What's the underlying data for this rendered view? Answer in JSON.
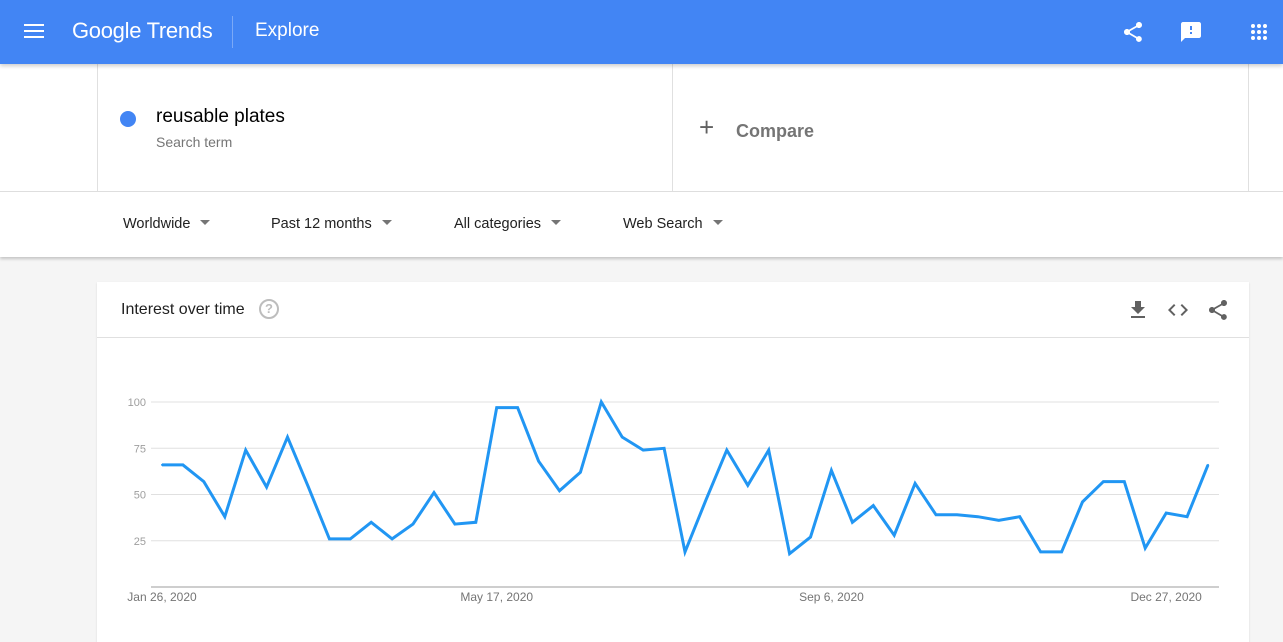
{
  "header": {
    "logo_google": "Google",
    "logo_trends": "Trends",
    "section": "Explore",
    "icons": [
      "menu-icon",
      "share-icon",
      "feedback-icon",
      "apps-icon"
    ]
  },
  "search": {
    "term": "reusable plates",
    "term_subtitle": "Search term",
    "term_color": "#4285f4",
    "compare_label": "Compare"
  },
  "filters": {
    "region": "Worldwide",
    "time": "Past 12 months",
    "category": "All categories",
    "property": "Web Search"
  },
  "card": {
    "title": "Interest over time",
    "help_glyph": "?",
    "icons": [
      "download-icon",
      "embed-icon",
      "share-icon"
    ]
  },
  "chart_data": {
    "type": "line",
    "title": "Interest over time",
    "xlabel": "",
    "ylabel": "",
    "ylim": [
      0,
      100
    ],
    "y_ticks": [
      25,
      50,
      75,
      100
    ],
    "x_tick_labels": [
      {
        "label": "Jan 26, 2020",
        "index": 0
      },
      {
        "label": "May 17, 2020",
        "index": 16
      },
      {
        "label": "Sep 6, 2020",
        "index": 32
      },
      {
        "label": "Dec 27, 2020",
        "index": 48
      }
    ],
    "grid": true,
    "legend": "none",
    "series": [
      {
        "name": "reusable plates",
        "color": "#2196f3",
        "values": [
          66,
          66,
          57,
          38,
          74,
          54,
          81,
          54,
          26,
          26,
          35,
          26,
          34,
          51,
          34,
          35,
          97,
          97,
          68,
          52,
          62,
          100,
          81,
          74,
          75,
          19,
          47,
          74,
          55,
          74,
          18,
          27,
          63,
          35,
          44,
          28,
          56,
          39,
          39,
          38,
          36,
          38,
          19,
          19,
          46,
          57,
          57,
          21,
          40,
          38,
          66
        ]
      }
    ]
  }
}
